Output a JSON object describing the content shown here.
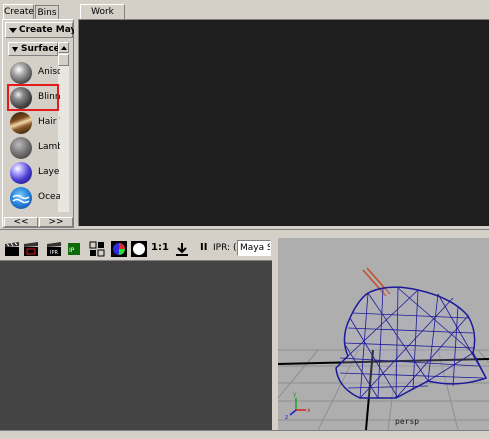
{
  "top_tabs": {
    "create": "Create",
    "bins": "Bins",
    "work_area": "Work Area"
  },
  "create_menu": "Create Maya",
  "section": {
    "label": "Surface"
  },
  "materials": [
    {
      "label": "Anisot",
      "icon": "anisotropic-icon"
    },
    {
      "label": "Blinn",
      "icon": "blinn-icon",
      "selected": true
    },
    {
      "label": "Hair T",
      "icon": "hair-tube-icon"
    },
    {
      "label": "Lambe",
      "icon": "lambert-icon"
    },
    {
      "label": "Layere",
      "icon": "layered-icon"
    },
    {
      "label": "Ocean",
      "icon": "ocean-icon"
    }
  ],
  "scroll_arrows": {
    "left": "<<",
    "right": ">>"
  },
  "render_toolbar": {
    "ratio_label": "1:1",
    "pause_label": "II",
    "ipr_label": "IPR: (",
    "renderer_value": "Maya So"
  },
  "viewport": {
    "camera_label": "persp"
  },
  "colors": {
    "selection_red": "#e31b1b",
    "mesh_blue": "#1d1a9a",
    "work_area_bg": "#1e1e1e"
  }
}
